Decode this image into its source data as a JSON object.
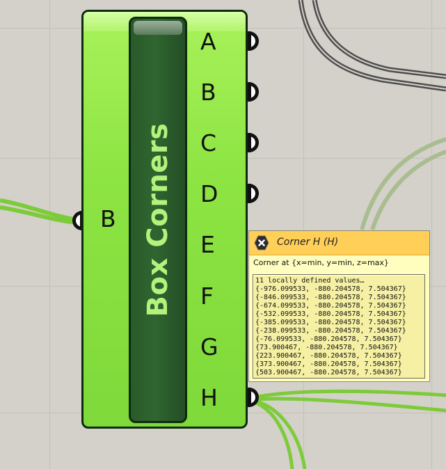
{
  "component": {
    "name": "Box Corners",
    "input_label": "B",
    "outputs": [
      "A",
      "B",
      "C",
      "D",
      "E",
      "F",
      "G",
      "H"
    ]
  },
  "tooltip": {
    "title": "Corner H (H)",
    "description": "Corner at {x=min, y=min, z=max}",
    "header_line": "11 locally defined values…",
    "values": [
      "{-976.099533, -880.204578, 7.504367}",
      "{-846.099533, -880.204578, 7.504367}",
      "{-674.099533, -880.204578, 7.504367}",
      "{-532.099533, -880.204578, 7.504367}",
      "{-385.099533, -880.204578, 7.504367}",
      "{-238.099533, -880.204578, 7.504367}",
      "{-76.099533, -880.204578, 7.504367}",
      "{73.900467, -880.204578, 7.504367}",
      "{223.900467, -880.204578, 7.504367}",
      "{373.900467, -880.204578, 7.504367}",
      "{503.900467, -880.204578, 7.504367}"
    ],
    "close_icon": "close-icon"
  },
  "colors": {
    "canvas": "#d3d1ca",
    "component_fill": "#8de443",
    "name_bar": "#2f6530",
    "tooltip_header": "#ffcf57",
    "tooltip_body": "#fffebf",
    "wire_green": "#7ecb3a"
  }
}
